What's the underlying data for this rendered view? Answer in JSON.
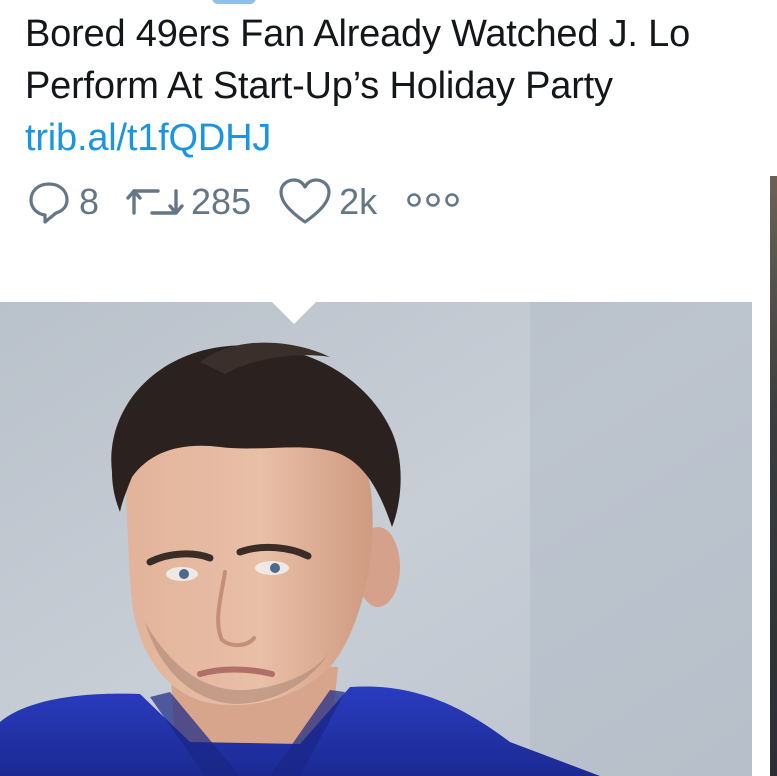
{
  "tweet": {
    "text_main": "Bored 49ers Fan Already Watched J. Lo Perform At Start-Up’s Holiday Party ",
    "link_text": "trib.al/t1fQDHJ"
  },
  "actions": {
    "reply": {
      "icon": "reply-icon",
      "count": "8"
    },
    "retweet": {
      "icon": "retweet-icon",
      "count": "285"
    },
    "like": {
      "icon": "heart-icon",
      "count": "2k"
    },
    "more": {
      "icon": "more-dots-icon"
    }
  },
  "colors": {
    "text": "#14171a",
    "link": "#1b95e0",
    "action": "#657786",
    "shirt": "#2334a8",
    "background_photo": "#c2c9d2"
  }
}
